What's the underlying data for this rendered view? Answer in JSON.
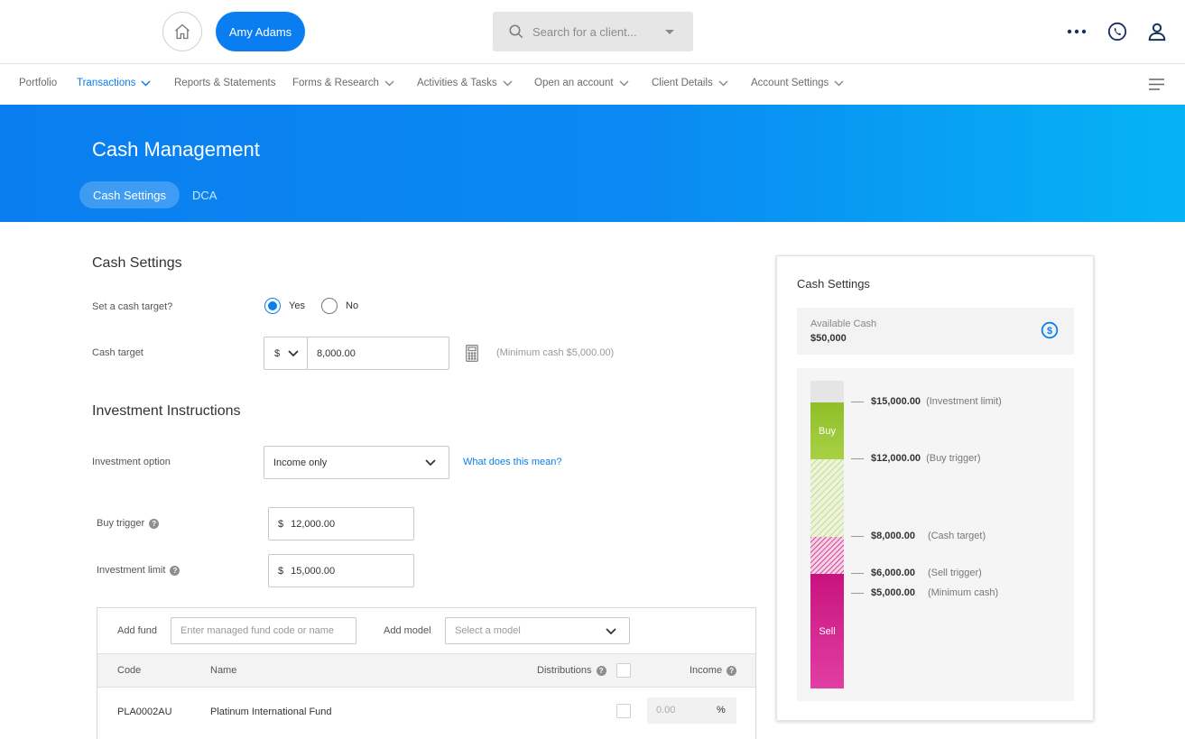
{
  "topbar": {
    "client_name": "Amy Adams",
    "search_placeholder": "Search for a client..."
  },
  "nav": {
    "items": [
      {
        "label": "Portfolio",
        "active": false,
        "dropdown": false
      },
      {
        "label": "Transactions",
        "active": true,
        "dropdown": true
      },
      {
        "label": "Reports & Statements",
        "active": false,
        "dropdown": false
      },
      {
        "label": "Forms & Research",
        "active": false,
        "dropdown": true
      },
      {
        "label": "Activities & Tasks",
        "active": false,
        "dropdown": true
      },
      {
        "label": "Open an account",
        "active": false,
        "dropdown": true
      },
      {
        "label": "Client Details",
        "active": false,
        "dropdown": true
      },
      {
        "label": "Account Settings",
        "active": false,
        "dropdown": true
      }
    ]
  },
  "banner": {
    "title": "Cash Management",
    "tabs": [
      {
        "label": "Cash Settings",
        "active": true
      },
      {
        "label": "DCA",
        "active": false
      }
    ]
  },
  "cash_settings": {
    "heading": "Cash Settings",
    "set_target_label": "Set a cash target?",
    "yes_label": "Yes",
    "no_label": "No",
    "selected": "Yes",
    "cash_target_label": "Cash target",
    "currency": "$",
    "cash_target_value": "8,000.00",
    "minimum_note": "(Minimum cash $5,000.00)"
  },
  "investment": {
    "heading": "Investment Instructions",
    "option_label": "Investment option",
    "option_value": "Income only",
    "help_link": "What does this mean?",
    "buy_trigger_label": "Buy trigger",
    "buy_trigger_currency": "$",
    "buy_trigger_value": "12,000.00",
    "limit_label": "Investment limit",
    "limit_currency": "$",
    "limit_value": "15,000.00"
  },
  "funds": {
    "add_fund_label": "Add fund",
    "add_fund_placeholder": "Enter managed fund code or name",
    "add_model_label": "Add model",
    "add_model_placeholder": "Select a model",
    "columns": {
      "code": "Code",
      "name": "Name",
      "distributions": "Distributions",
      "income": "Income"
    },
    "rows": [
      {
        "code": "PLA0002AU",
        "name": "Platinum International Fund",
        "income_placeholder": "0.00",
        "unit": "%"
      }
    ]
  },
  "panel": {
    "title": "Cash Settings",
    "available_label": "Available Cash",
    "available_value": "$50,000",
    "buy_label": "Buy",
    "sell_label": "Sell",
    "levels": [
      {
        "value": "$15,000.00",
        "desc": "(Investment limit)"
      },
      {
        "value": "$12,000.00",
        "desc": "(Buy trigger)"
      },
      {
        "value": "$8,000.00",
        "desc": "(Cash target)"
      },
      {
        "value": "$6,000.00",
        "desc": "(Sell trigger)"
      },
      {
        "value": "$5,000.00",
        "desc": "(Minimum cash)"
      }
    ]
  },
  "colors": {
    "primary": "#0a7ef0",
    "buy": "#9ec93a",
    "sell": "#d41f8c"
  }
}
